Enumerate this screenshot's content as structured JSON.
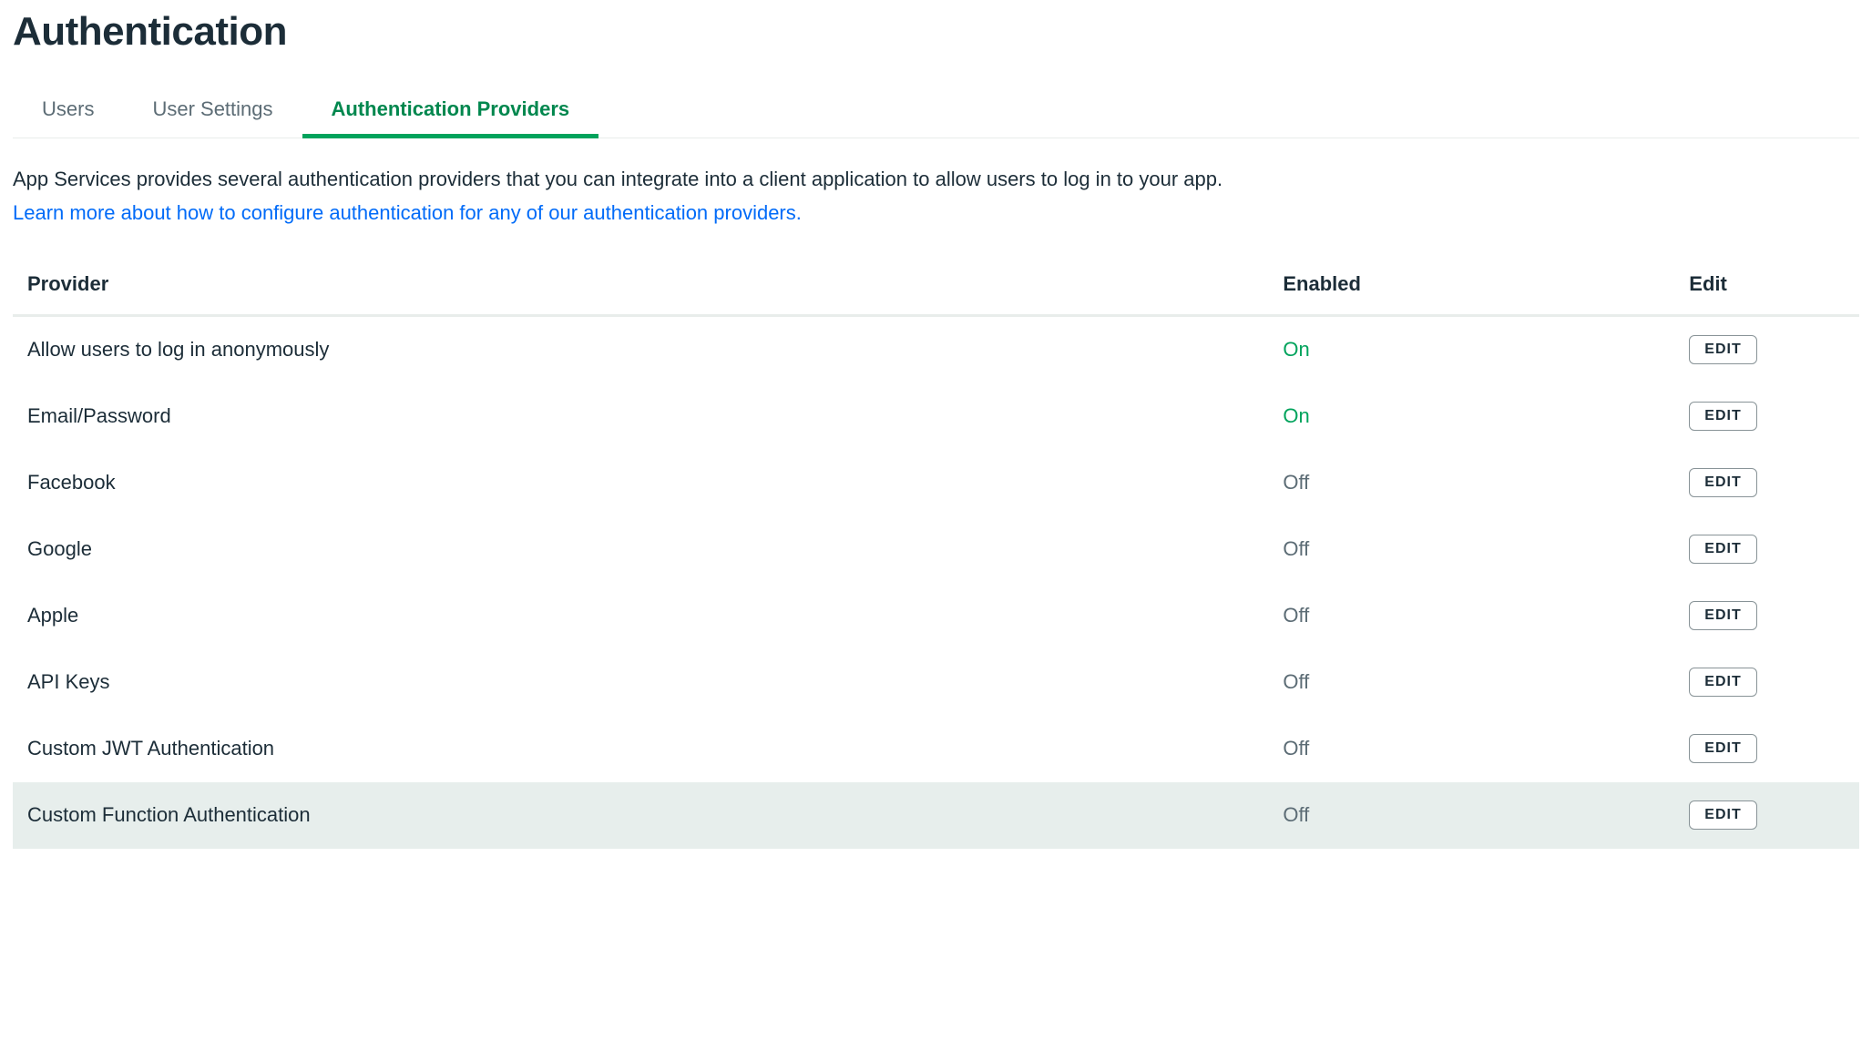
{
  "header": {
    "title": "Authentication"
  },
  "tabs": [
    {
      "label": "Users",
      "active": false
    },
    {
      "label": "User Settings",
      "active": false
    },
    {
      "label": "Authentication Providers",
      "active": true
    }
  ],
  "description": "App Services provides several authentication providers that you can integrate into a client application to allow users to log in to your app.",
  "learn_more": "Learn more about how to configure authentication for any of our authentication providers.",
  "table": {
    "columns": {
      "provider": "Provider",
      "enabled": "Enabled",
      "edit": "Edit"
    },
    "edit_button_label": "EDIT",
    "rows": [
      {
        "provider": "Allow users to log in anonymously",
        "enabled": true,
        "status_label": "On",
        "highlighted": false
      },
      {
        "provider": "Email/Password",
        "enabled": true,
        "status_label": "On",
        "highlighted": false
      },
      {
        "provider": "Facebook",
        "enabled": false,
        "status_label": "Off",
        "highlighted": false
      },
      {
        "provider": "Google",
        "enabled": false,
        "status_label": "Off",
        "highlighted": false
      },
      {
        "provider": "Apple",
        "enabled": false,
        "status_label": "Off",
        "highlighted": false
      },
      {
        "provider": "API Keys",
        "enabled": false,
        "status_label": "Off",
        "highlighted": false
      },
      {
        "provider": "Custom JWT Authentication",
        "enabled": false,
        "status_label": "Off",
        "highlighted": false
      },
      {
        "provider": "Custom Function Authentication",
        "enabled": false,
        "status_label": "Off",
        "highlighted": true
      }
    ]
  }
}
